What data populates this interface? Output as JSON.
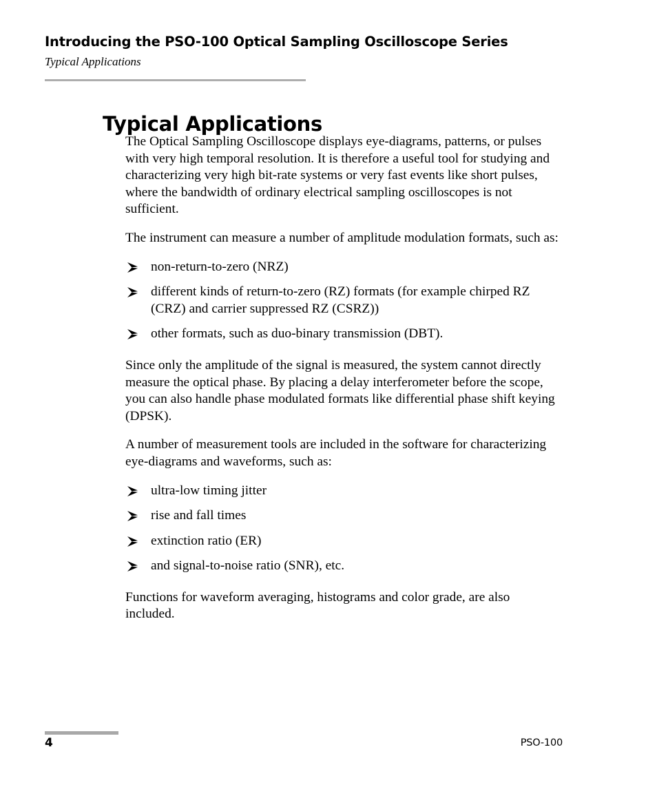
{
  "header": {
    "title": "Introducing the PSO-100 Optical Sampling Oscilloscope Series",
    "subtitle": "Typical Applications",
    "rule_color": "#adadad"
  },
  "main": {
    "heading": "Typical Applications",
    "paragraph_1": "The Optical Sampling Oscilloscope displays eye-diagrams, patterns, or pulses with very high temporal resolution. It is therefore a useful tool for studying and characterizing very high bit-rate systems or very fast events like short pulses, where the bandwidth of ordinary electrical sampling oscilloscopes is not sufficient.",
    "paragraph_2": "The instrument can measure a number of amplitude modulation formats, such as:",
    "list_1": [
      "non-return-to-zero (NRZ)",
      "different kinds of return-to-zero (RZ) formats (for example chirped RZ (CRZ) and carrier suppressed RZ (CSRZ))",
      "other formats, such as duo-binary transmission (DBT)."
    ],
    "paragraph_3": "Since only the amplitude of the signal is measured, the system cannot directly measure the optical phase. By placing a delay interferometer before the scope, you can also handle phase modulated formats like differential phase shift keying (DPSK).",
    "paragraph_4": "A number of measurement tools are included in the software for characterizing eye-diagrams and waveforms, such as:",
    "list_2": [
      "ultra-low timing jitter",
      "rise and fall times",
      "extinction ratio (ER)",
      "and signal-to-noise ratio (SNR), etc."
    ],
    "paragraph_5": "Functions for waveform averaging, histograms and color grade, are also included.",
    "bullet_icon": "arrowhead-right-icon"
  },
  "footer": {
    "page_number": "4",
    "product": "PSO-100",
    "rule_color": "#a8a8a8"
  }
}
